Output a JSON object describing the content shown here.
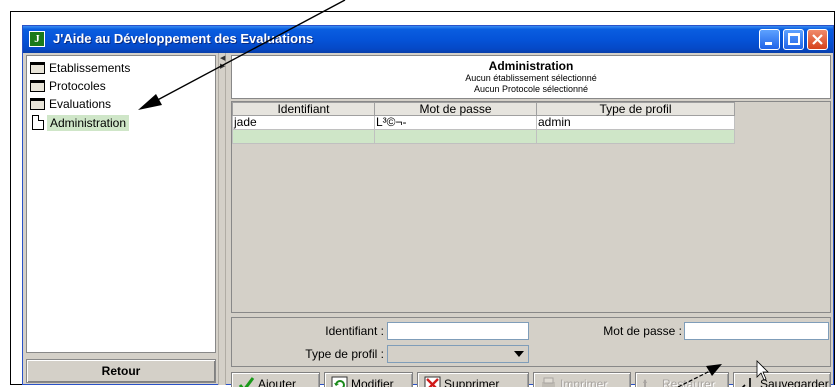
{
  "window": {
    "title": "J'Aide au Développement des Evaluations",
    "icon_letter": "J"
  },
  "tree": {
    "items": [
      {
        "label": "Etablissements",
        "icon": "folder-icon"
      },
      {
        "label": "Protocoles",
        "icon": "folder-icon"
      },
      {
        "label": "Evaluations",
        "icon": "folder-icon"
      },
      {
        "label": "Administration",
        "icon": "document-icon",
        "selected": true
      }
    ]
  },
  "retour_label": "Retour",
  "header": {
    "title": "Administration",
    "line1": "Aucun établissement sélectionné",
    "line2": "Aucun Protocole sélectionné"
  },
  "table": {
    "columns": [
      "Identifiant",
      "Mot de passe",
      "Type de profil"
    ],
    "rows": [
      [
        "jade",
        "L³©¬-",
        "admin"
      ]
    ]
  },
  "form": {
    "identifiant_label": "Identifiant :",
    "identifiant_value": "",
    "mot_de_passe_label": "Mot de passe :",
    "mot_de_passe_value": "",
    "type_profil_label": "Type de profil :",
    "type_profil_value": ""
  },
  "toolbar": {
    "ajouter": "Ajouter",
    "modifier": "Modifier",
    "supprimer": "Supprimer",
    "imprimer": "Imprimer",
    "restaurer": "Restaurer",
    "sauvegarder": "Sauvegarder"
  },
  "colors": {
    "titlebar": "#0553d8",
    "selection_green": "#cfe6c8",
    "panel_gray": "#d4d0c8"
  }
}
